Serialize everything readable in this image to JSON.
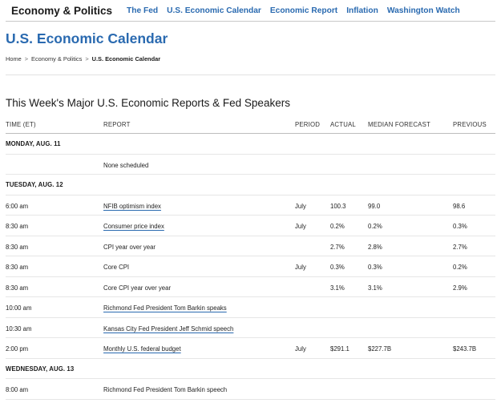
{
  "nav": {
    "section": "Economy & Politics",
    "links": [
      "The Fed",
      "U.S. Economic Calendar",
      "Economic Report",
      "Inflation",
      "Washington Watch"
    ]
  },
  "page": {
    "title": "U.S. Economic Calendar",
    "breadcrumb": [
      "Home",
      "Economy & Politics",
      "U.S. Economic Calendar"
    ],
    "breadcrumb_sep": ">"
  },
  "section_title": "This Week's Major U.S. Economic Reports & Fed Speakers",
  "table": {
    "headers": {
      "time": "TIME (ET)",
      "report": "REPORT",
      "period": "PERIOD",
      "actual": "ACTUAL",
      "median": "MEDIAN FORECAST",
      "previous": "PREVIOUS"
    },
    "rows": [
      {
        "day": "MONDAY, AUG. 11"
      },
      {
        "time": "",
        "report": "None scheduled",
        "link": false,
        "period": "",
        "actual": "",
        "median": "",
        "previous": ""
      },
      {
        "day": "TUESDAY, AUG. 12"
      },
      {
        "time": "6:00 am",
        "report": "NFIB optimism index",
        "link": true,
        "period": "July",
        "actual": "100.3",
        "median": "99.0",
        "previous": "98.6"
      },
      {
        "time": "8:30 am",
        "report": "Consumer price index",
        "link": true,
        "period": "July",
        "actual": "0.2%",
        "median": "0.2%",
        "previous": "0.3%"
      },
      {
        "time": "8:30 am",
        "report": "CPI year over year",
        "link": false,
        "period": "",
        "actual": "2.7%",
        "median": "2.8%",
        "previous": "2.7%"
      },
      {
        "time": "8:30 am",
        "report": "Core CPI",
        "link": false,
        "period": "July",
        "actual": "0.3%",
        "median": "0.3%",
        "previous": "0.2%"
      },
      {
        "time": "8:30 am",
        "report": "Core CPI year over year",
        "link": false,
        "period": "",
        "actual": "3.1%",
        "median": "3.1%",
        "previous": "2.9%"
      },
      {
        "time": "10:00 am",
        "report": "Richmond Fed President Tom Barkin speaks",
        "link": true,
        "period": "",
        "actual": "",
        "median": "",
        "previous": ""
      },
      {
        "time": "10:30 am",
        "report": "Kansas City Fed President Jeff Schmid speech",
        "link": true,
        "period": "",
        "actual": "",
        "median": "",
        "previous": ""
      },
      {
        "time": "2:00 pm",
        "report": "Monthly U.S. federal budget",
        "link": true,
        "period": "July",
        "actual": "$291.1",
        "median": "$227.7B",
        "previous": "$243.7B"
      },
      {
        "day": "WEDNESDAY, AUG. 13"
      },
      {
        "time": "8:00 am",
        "report": "Richmond Fed President Tom Barkin speech",
        "link": false,
        "period": "",
        "actual": "",
        "median": "",
        "previous": ""
      }
    ]
  }
}
